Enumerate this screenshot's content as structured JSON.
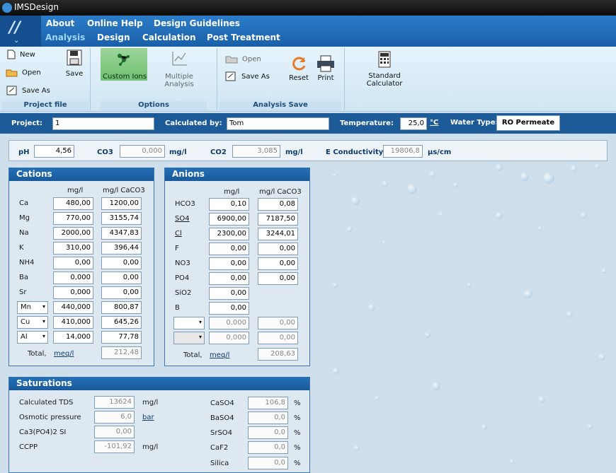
{
  "app": {
    "title": "IMSDesign"
  },
  "menu": {
    "top": [
      "About",
      "Online Help",
      "Design Guidelines"
    ],
    "main": [
      "Analysis",
      "Design",
      "Calculation",
      "Post Treatment"
    ]
  },
  "ribbon": {
    "project_file": {
      "label": "Project file",
      "new": "New",
      "open": "Open",
      "save_as": "Save As",
      "save": "Save"
    },
    "options": {
      "label": "Options",
      "custom_ions": "Custom Ions",
      "multiple_analysis": "Multiple Analysis"
    },
    "analysis_save": {
      "label": "Analysis Save",
      "open": "Open",
      "save_as": "Save As",
      "reset": "Reset",
      "print": "Print"
    },
    "standard_calculator": "Standard Calculator"
  },
  "project": {
    "project_label": "Project:",
    "project_value": "1",
    "calculated_by_label": "Calculated by:",
    "calculated_by_value": "Tom",
    "temperature_label": "Temperature:",
    "temperature_value": "25,0",
    "temperature_unit": "°C",
    "water_type_label": "Water Type:",
    "water_type_value": "RO Permeate"
  },
  "ph_bar": {
    "ph_label": "pH",
    "ph_value": "4,56",
    "co3_label": "CO3",
    "co3_value": "0,000",
    "co3_unit": "mg/l",
    "co2_label": "CO2",
    "co2_value": "3,085",
    "co2_unit": "mg/l",
    "cond_label": "E Conductivity",
    "cond_value": "19806,8",
    "cond_unit": "µs/cm"
  },
  "cations": {
    "title": "Cations",
    "col1": "mg/l",
    "col2": "mg/l CaCO3",
    "rows": [
      {
        "ion": "Ca",
        "mg": "480,00",
        "caco3": "1200,00"
      },
      {
        "ion": "Mg",
        "mg": "770,00",
        "caco3": "3155,74"
      },
      {
        "ion": "Na",
        "mg": "2000,00",
        "caco3": "4347,83"
      },
      {
        "ion": "K",
        "mg": "310,00",
        "caco3": "396,44"
      },
      {
        "ion": "NH4",
        "mg": "0,00",
        "caco3": "0,00"
      },
      {
        "ion": "Ba",
        "mg": "0,000",
        "caco3": "0,00"
      },
      {
        "ion": "Sr",
        "mg": "0,000",
        "caco3": "0,00"
      },
      {
        "ion": "Mn",
        "mg": "440,000",
        "caco3": "800,87"
      },
      {
        "ion": "Cu",
        "mg": "410,000",
        "caco3": "645,26"
      },
      {
        "ion": "Al",
        "mg": "14,000",
        "caco3": "77,78"
      }
    ],
    "total_label": "Total,",
    "total_unit": "meq/l",
    "total_value": "212,48"
  },
  "anions": {
    "title": "Anions",
    "col1": "mg/l",
    "col2": "mg/l CaCO3",
    "rows": [
      {
        "ion": "HCO3",
        "mg": "0,10",
        "caco3": "0,08"
      },
      {
        "ion": "SO4",
        "mg": "6900,00",
        "caco3": "7187,50"
      },
      {
        "ion": "Cl",
        "mg": "2300,00",
        "caco3": "3244,01"
      },
      {
        "ion": "F",
        "mg": "0,00",
        "caco3": "0,00"
      },
      {
        "ion": "NO3",
        "mg": "0,00",
        "caco3": "0,00"
      },
      {
        "ion": "PO4",
        "mg": "0,00",
        "caco3": "0,00"
      },
      {
        "ion": "SiO2",
        "mg": "0,00",
        "caco3": ""
      },
      {
        "ion": "B",
        "mg": "0,00",
        "caco3": ""
      },
      {
        "ion": "",
        "mg": "0,000",
        "caco3": "0,00"
      },
      {
        "ion": "",
        "mg": "0,000",
        "caco3": "0,00"
      }
    ],
    "total_label": "Total,",
    "total_unit": "meq/l",
    "total_value": "208,63"
  },
  "saturations": {
    "title": "Saturations",
    "left": [
      {
        "label": "Calculated TDS",
        "value": "13624",
        "unit": "mg/l"
      },
      {
        "label": "Osmotic pressure",
        "value": "6,0",
        "unit": "bar"
      },
      {
        "label": "Ca3(PO4)2 SI",
        "value": "0,00",
        "unit": ""
      },
      {
        "label": "CCPP",
        "value": "-101,92",
        "unit": "mg/l"
      }
    ],
    "right": [
      {
        "label": "CaSO4",
        "value": "106,8",
        "unit": "%"
      },
      {
        "label": "BaSO4",
        "value": "0,0",
        "unit": "%"
      },
      {
        "label": "SrSO4",
        "value": "0,0",
        "unit": "%"
      },
      {
        "label": "CaF2",
        "value": "0,0",
        "unit": "%"
      },
      {
        "label": "Silica",
        "value": "0,0",
        "unit": "%"
      }
    ]
  }
}
